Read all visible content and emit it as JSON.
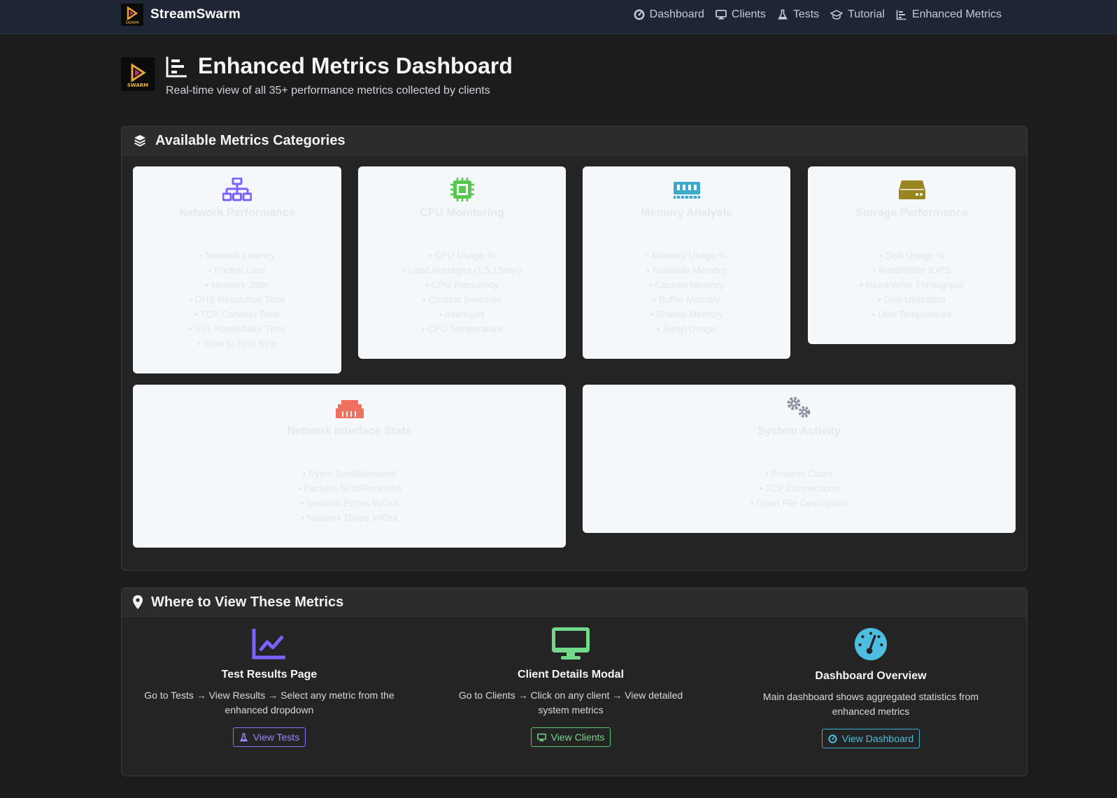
{
  "navbar": {
    "brand": "StreamSwarm",
    "items": [
      {
        "label": "Dashboard",
        "icon": "gauge-icon"
      },
      {
        "label": "Clients",
        "icon": "desktop-icon"
      },
      {
        "label": "Tests",
        "icon": "flask-icon"
      },
      {
        "label": "Tutorial",
        "icon": "graduation-cap-icon"
      },
      {
        "label": "Enhanced Metrics",
        "icon": "chart-bar-icon"
      }
    ]
  },
  "logo_text": "SWARM",
  "header": {
    "title": "Enhanced Metrics Dashboard",
    "subtitle": "Real-time view of all 35+ performance metrics collected by clients"
  },
  "categories": {
    "title": "Available Metrics Categories",
    "tiles": [
      {
        "title": "Network Performance",
        "icon": "network-wired-icon",
        "color": "#7b61ff",
        "items": [
          "• Network Latency",
          "• Packet Loss",
          "• Network Jitter",
          "• DNS Resolution Time",
          "• TCP Connect Time",
          "• SSL Handshake Time",
          "• Time to First Byte"
        ]
      },
      {
        "title": "CPU Monitoring",
        "icon": "microchip-icon",
        "color": "#57c84d",
        "items": [
          "• CPU Usage %",
          "• Load Averages (1,5,15min)",
          "• CPU Frequency",
          "• Context Switches",
          "• Interrupts",
          "• CPU Temperature"
        ]
      },
      {
        "title": "Memory Analysis",
        "icon": "memory-icon",
        "color": "#3fa9c9",
        "items": [
          "• Memory Usage %",
          "• Available Memory",
          "• Cached Memory",
          "• Buffer Memory",
          "• Shared Memory",
          "• Swap Usage"
        ]
      },
      {
        "title": "Storage Performance",
        "icon": "hdd-icon",
        "color": "#9a8620",
        "items": [
          "• Disk Usage %",
          "• Read/Write IOPS",
          "• Read/Write Throughput",
          "• Disk Utilization",
          "• Disk Temperature"
        ]
      },
      {
        "title": "Network Interface Stats",
        "icon": "ethernet-icon",
        "color": "#f07060",
        "items": [
          "• Bytes Sent/Received",
          "• Packets Sent/Received",
          "• Network Errors In/Out",
          "• Network Drops In/Out"
        ]
      },
      {
        "title": "System Activity",
        "icon": "cogs-icon",
        "color": "#8c93a3",
        "items": [
          "• Process Count",
          "• TCP Connections",
          "• Open File Descriptors"
        ]
      }
    ]
  },
  "where": {
    "title": "Where to View These Metrics",
    "cols": [
      {
        "title": "Test Results Page",
        "desc": "Go to Tests → View Results → Select any metric from the enhanced dropdown",
        "button": "View Tests",
        "color": "#9b87ff"
      },
      {
        "title": "Client Details Modal",
        "desc": "Go to Clients → Click on any client → View detailed system metrics",
        "button": "View Clients",
        "color": "#72d88a"
      },
      {
        "title": "Dashboard Overview",
        "desc": "Main dashboard shows aggregated statistics from enhanced metrics",
        "button": "View Dashboard",
        "color": "#4dbde0"
      }
    ]
  }
}
